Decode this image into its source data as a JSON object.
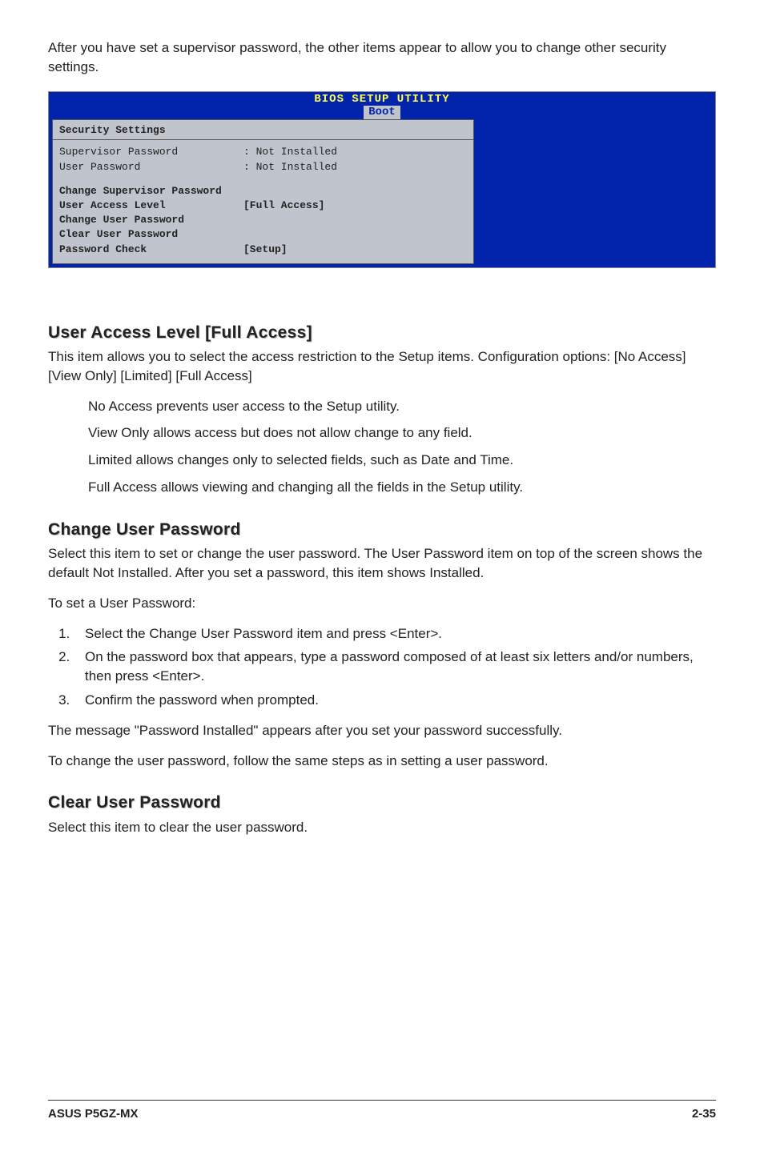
{
  "intro": "After you have set a supervisor password, the other items appear to allow you to change other security settings.",
  "bios": {
    "title": "BIOS SETUP UTILITY",
    "tab": "Boot",
    "panel_title": "Security Settings",
    "rows_top": [
      {
        "label": "Supervisor Password",
        "value": ": Not Installed"
      },
      {
        "label": "User Password",
        "value": ": Not Installed"
      }
    ],
    "rows_bold": [
      {
        "label": "Change Supervisor Password",
        "value": ""
      },
      {
        "label": "User Access Level",
        "value": "[Full Access]"
      },
      {
        "label": "Change User Password",
        "value": ""
      },
      {
        "label": "Clear User Password",
        "value": ""
      },
      {
        "label": "Password Check",
        "value": "[Setup]"
      }
    ]
  },
  "sec1": {
    "heading": "User Access Level [Full Access]",
    "p1": "This item allows you to select the access restriction to the Setup items. Configuration options: [No Access] [View Only] [Limited] [Full Access]",
    "b1": "No Access prevents user access to the Setup utility.",
    "b2": "View Only allows access but does not allow change to any field.",
    "b3": "Limited allows changes only to selected fields, such as Date and Time.",
    "b4": "Full Access allows viewing and changing all the fields in the Setup utility."
  },
  "sec2": {
    "heading": "Change User Password",
    "p1": "Select this item to set or change the user password. The User Password item on top of the screen shows the default Not Installed. After you set a password, this item shows Installed.",
    "p2": "To set a User Password:",
    "steps": [
      "Select the Change User Password item and press <Enter>.",
      "On the password box that appears, type a password composed of at least six letters and/or numbers, then press <Enter>.",
      "Confirm the password when prompted."
    ],
    "p3": "The message \"Password Installed\" appears after you set your password successfully.",
    "p4": "To change the user password, follow the same steps as in setting a user password."
  },
  "sec3": {
    "heading": "Clear User Password",
    "p1": "Select this item to clear the user password."
  },
  "footer": {
    "left": "ASUS P5GZ-MX",
    "right": "2-35"
  }
}
